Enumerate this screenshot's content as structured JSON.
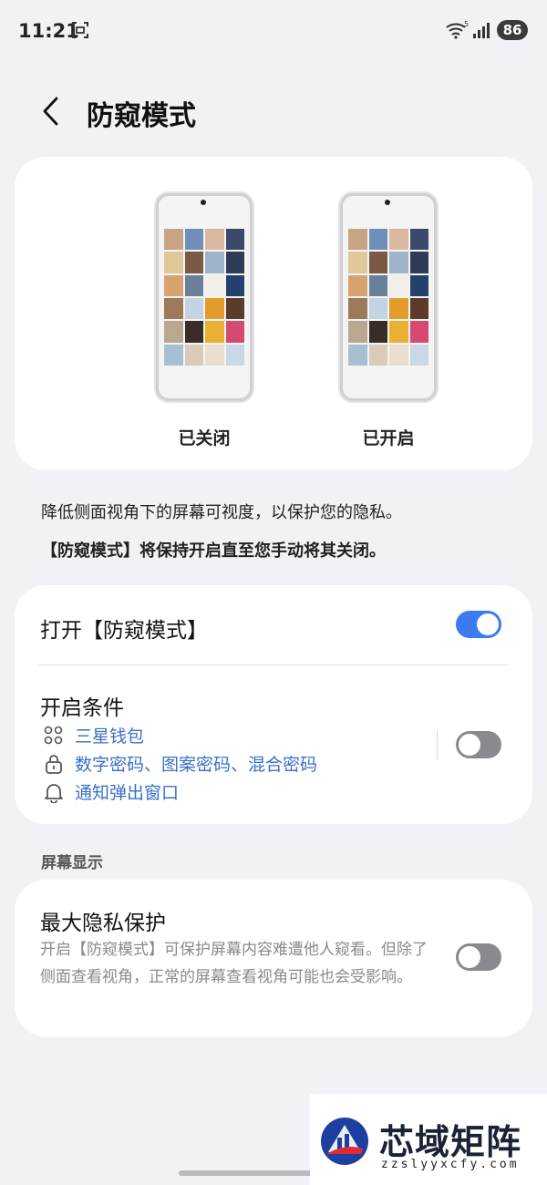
{
  "status_bar": {
    "time": "11:21",
    "battery": "86"
  },
  "header": {
    "title": "防窥模式"
  },
  "preview": {
    "off_label": "已关闭",
    "on_label": "已开启"
  },
  "description": {
    "line1": "降低侧面视角下的屏幕可视度，以保护您的隐私。",
    "line2": "【防窥模式】将保持开启直至您手动将其关闭。"
  },
  "settings": {
    "toggle_label": "打开【防窥模式】",
    "toggle_on": true,
    "conditions": {
      "title": "开启条件",
      "items": [
        {
          "icon": "apps-icon",
          "label": "三星钱包"
        },
        {
          "icon": "lock-icon",
          "label": "数字密码、图案密码、混合密码"
        },
        {
          "icon": "bell-icon",
          "label": "通知弹出窗口"
        }
      ],
      "switch_on": false
    }
  },
  "screen_display": {
    "section_title": "屏幕显示",
    "max_privacy": {
      "title": "最大隐私保护",
      "description": "开启【防窥模式】可保护屏幕内容难遭他人窥看。但除了侧面查看视角，正常的屏幕查看视角可能也会受影响。",
      "switch_on": false
    }
  },
  "watermark": {
    "name": "芯域矩阵",
    "url": "zzslyyxcfy.com"
  },
  "colors": {
    "accent": "#3a7bf0",
    "link": "#3a6fc7",
    "background": "#f2f2f6"
  }
}
